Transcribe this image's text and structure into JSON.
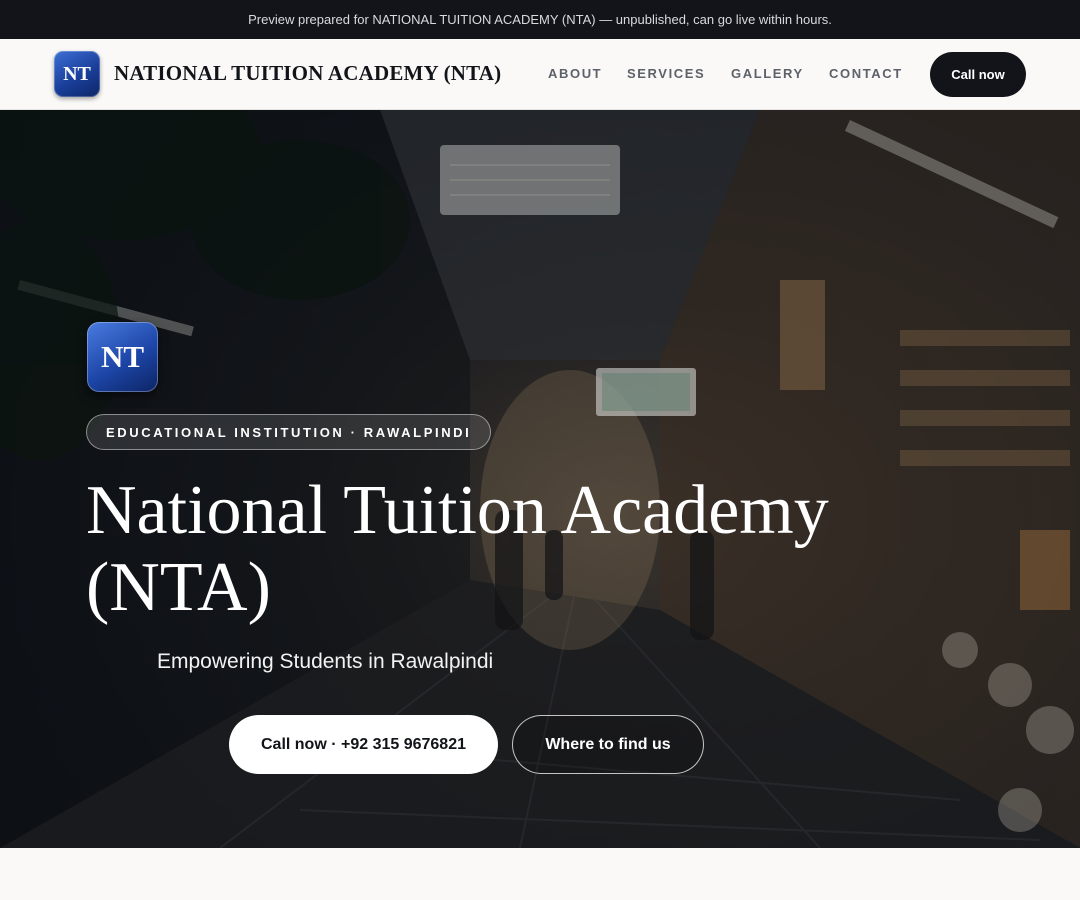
{
  "preview_bar": {
    "text": "Preview prepared for NATIONAL TUITION ACADEMY (NTA) — unpublished, can go live within hours."
  },
  "header": {
    "logo_text": "NT",
    "brand_name": "NATIONAL TUITION ACADEMY (NTA)",
    "nav": [
      {
        "label": "ABOUT"
      },
      {
        "label": "SERVICES"
      },
      {
        "label": "GALLERY"
      },
      {
        "label": "CONTACT"
      }
    ],
    "call_label": "Call now"
  },
  "hero": {
    "logo_text": "NT",
    "badge": "EDUCATIONAL INSTITUTION · RAWALPINDI",
    "title": "National Tuition Academy (NTA)",
    "subtitle": "Empowering Students in Rawalpindi",
    "call_button": "Call now · +92 315 9676821",
    "find_button": "Where to find us"
  },
  "colors": {
    "dark": "#121419",
    "logo_blue": "#1d46a8",
    "page_bg": "#faf9f7"
  }
}
